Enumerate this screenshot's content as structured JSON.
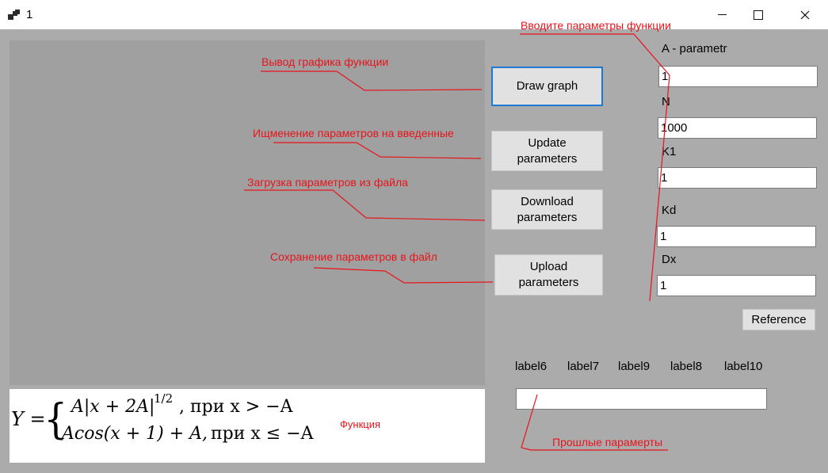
{
  "window": {
    "title": "1"
  },
  "buttons": {
    "draw_graph": "Draw graph",
    "update_parameters": "Update parameters",
    "download_parameters": "Download parameters",
    "upload_parameters": "Upload parameters",
    "reference": "Reference"
  },
  "parameters": [
    {
      "label": "A - parametr",
      "value": "1"
    },
    {
      "label": "N",
      "value": "1000"
    },
    {
      "label": "K1",
      "value": "1"
    },
    {
      "label": "Kd",
      "value": "1"
    },
    {
      "label": "Dx",
      "value": "1"
    }
  ],
  "labels": [
    "label6",
    "label7",
    "label9",
    "label8",
    "label10"
  ],
  "history": {
    "value": ""
  },
  "annotations": {
    "enter_params": "Вводите параметры функции",
    "draw_output": "Вывод графика функции",
    "update_change": "Ищменение параметров на введенные",
    "download_load": "Загрузка параметров из файла",
    "upload_save": "Сохранение параметров в файл",
    "function": "Функция",
    "previous_params": "Прошлые парамерты"
  },
  "formula": {
    "lhs": "Y =",
    "case1_expr": "A|x + 2A|",
    "case1_power": "1/2",
    "case1_cond": ",  при x > −A",
    "case2_expr": "Acos(x + 1) + A,",
    "case2_cond": " при x ≤ −A"
  },
  "colors": {
    "annotation": "#e8141b",
    "focus_border": "#1f78d1",
    "form_bg": "#ababab"
  }
}
